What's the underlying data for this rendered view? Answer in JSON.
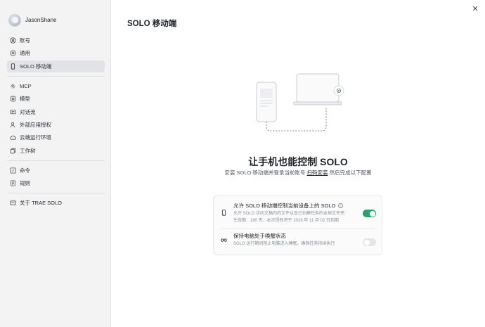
{
  "profile": {
    "username": "JasonShane"
  },
  "sidebar": {
    "items": [
      {
        "label": "账号",
        "icon": "user-circle-icon"
      },
      {
        "label": "通用",
        "icon": "settings-icon"
      },
      {
        "label": "SOLO 移动端",
        "icon": "phone-icon",
        "active": true
      },
      {
        "label": "MCP",
        "icon": "mcp-icon"
      },
      {
        "label": "模型",
        "icon": "model-icon"
      },
      {
        "label": "对话流",
        "icon": "chat-flow-icon"
      },
      {
        "label": "外部应用授权",
        "icon": "auth-user-icon"
      },
      {
        "label": "云端运行环境",
        "icon": "cloud-icon"
      },
      {
        "label": "工作树",
        "icon": "worktree-icon"
      },
      {
        "label": "命令",
        "icon": "command-icon"
      },
      {
        "label": "规则",
        "icon": "rules-icon"
      },
      {
        "label": "关于 TRAE SOLO",
        "icon": "about-icon"
      }
    ]
  },
  "page": {
    "title": "SOLO 移动端"
  },
  "hero": {
    "title": "让手机也能控制 SOLO",
    "subtitle_pre": "安装 SOLO 移动端并登录当前账号 ",
    "subtitle_link": "扫码安装",
    "subtitle_post": " 然后完成以下配置"
  },
  "settings": {
    "remote_control": {
      "title": "允许 SOLO 移动端控制当前设备上的 SOLO",
      "desc_line1": "允许 SOLO 访问文稿内的文件以及已创建任务的本地文件夹;",
      "desc_line2": "生效期：180 天；本次授权将于 2026 年 11 月 02 日到期",
      "enabled": true,
      "icon": "phone-icon"
    },
    "keep_awake": {
      "title": "保持电脑处于唤醒状态",
      "desc": "SOLO 运行期间阻止电脑进入睡眠，确保任务持续执行",
      "enabled": false,
      "icon": "infinity-icon"
    }
  },
  "colors": {
    "toggle_on": "#2e9e6a",
    "sidebar_bg": "#f3f3f4",
    "active_item_bg": "#e2e3e7"
  }
}
